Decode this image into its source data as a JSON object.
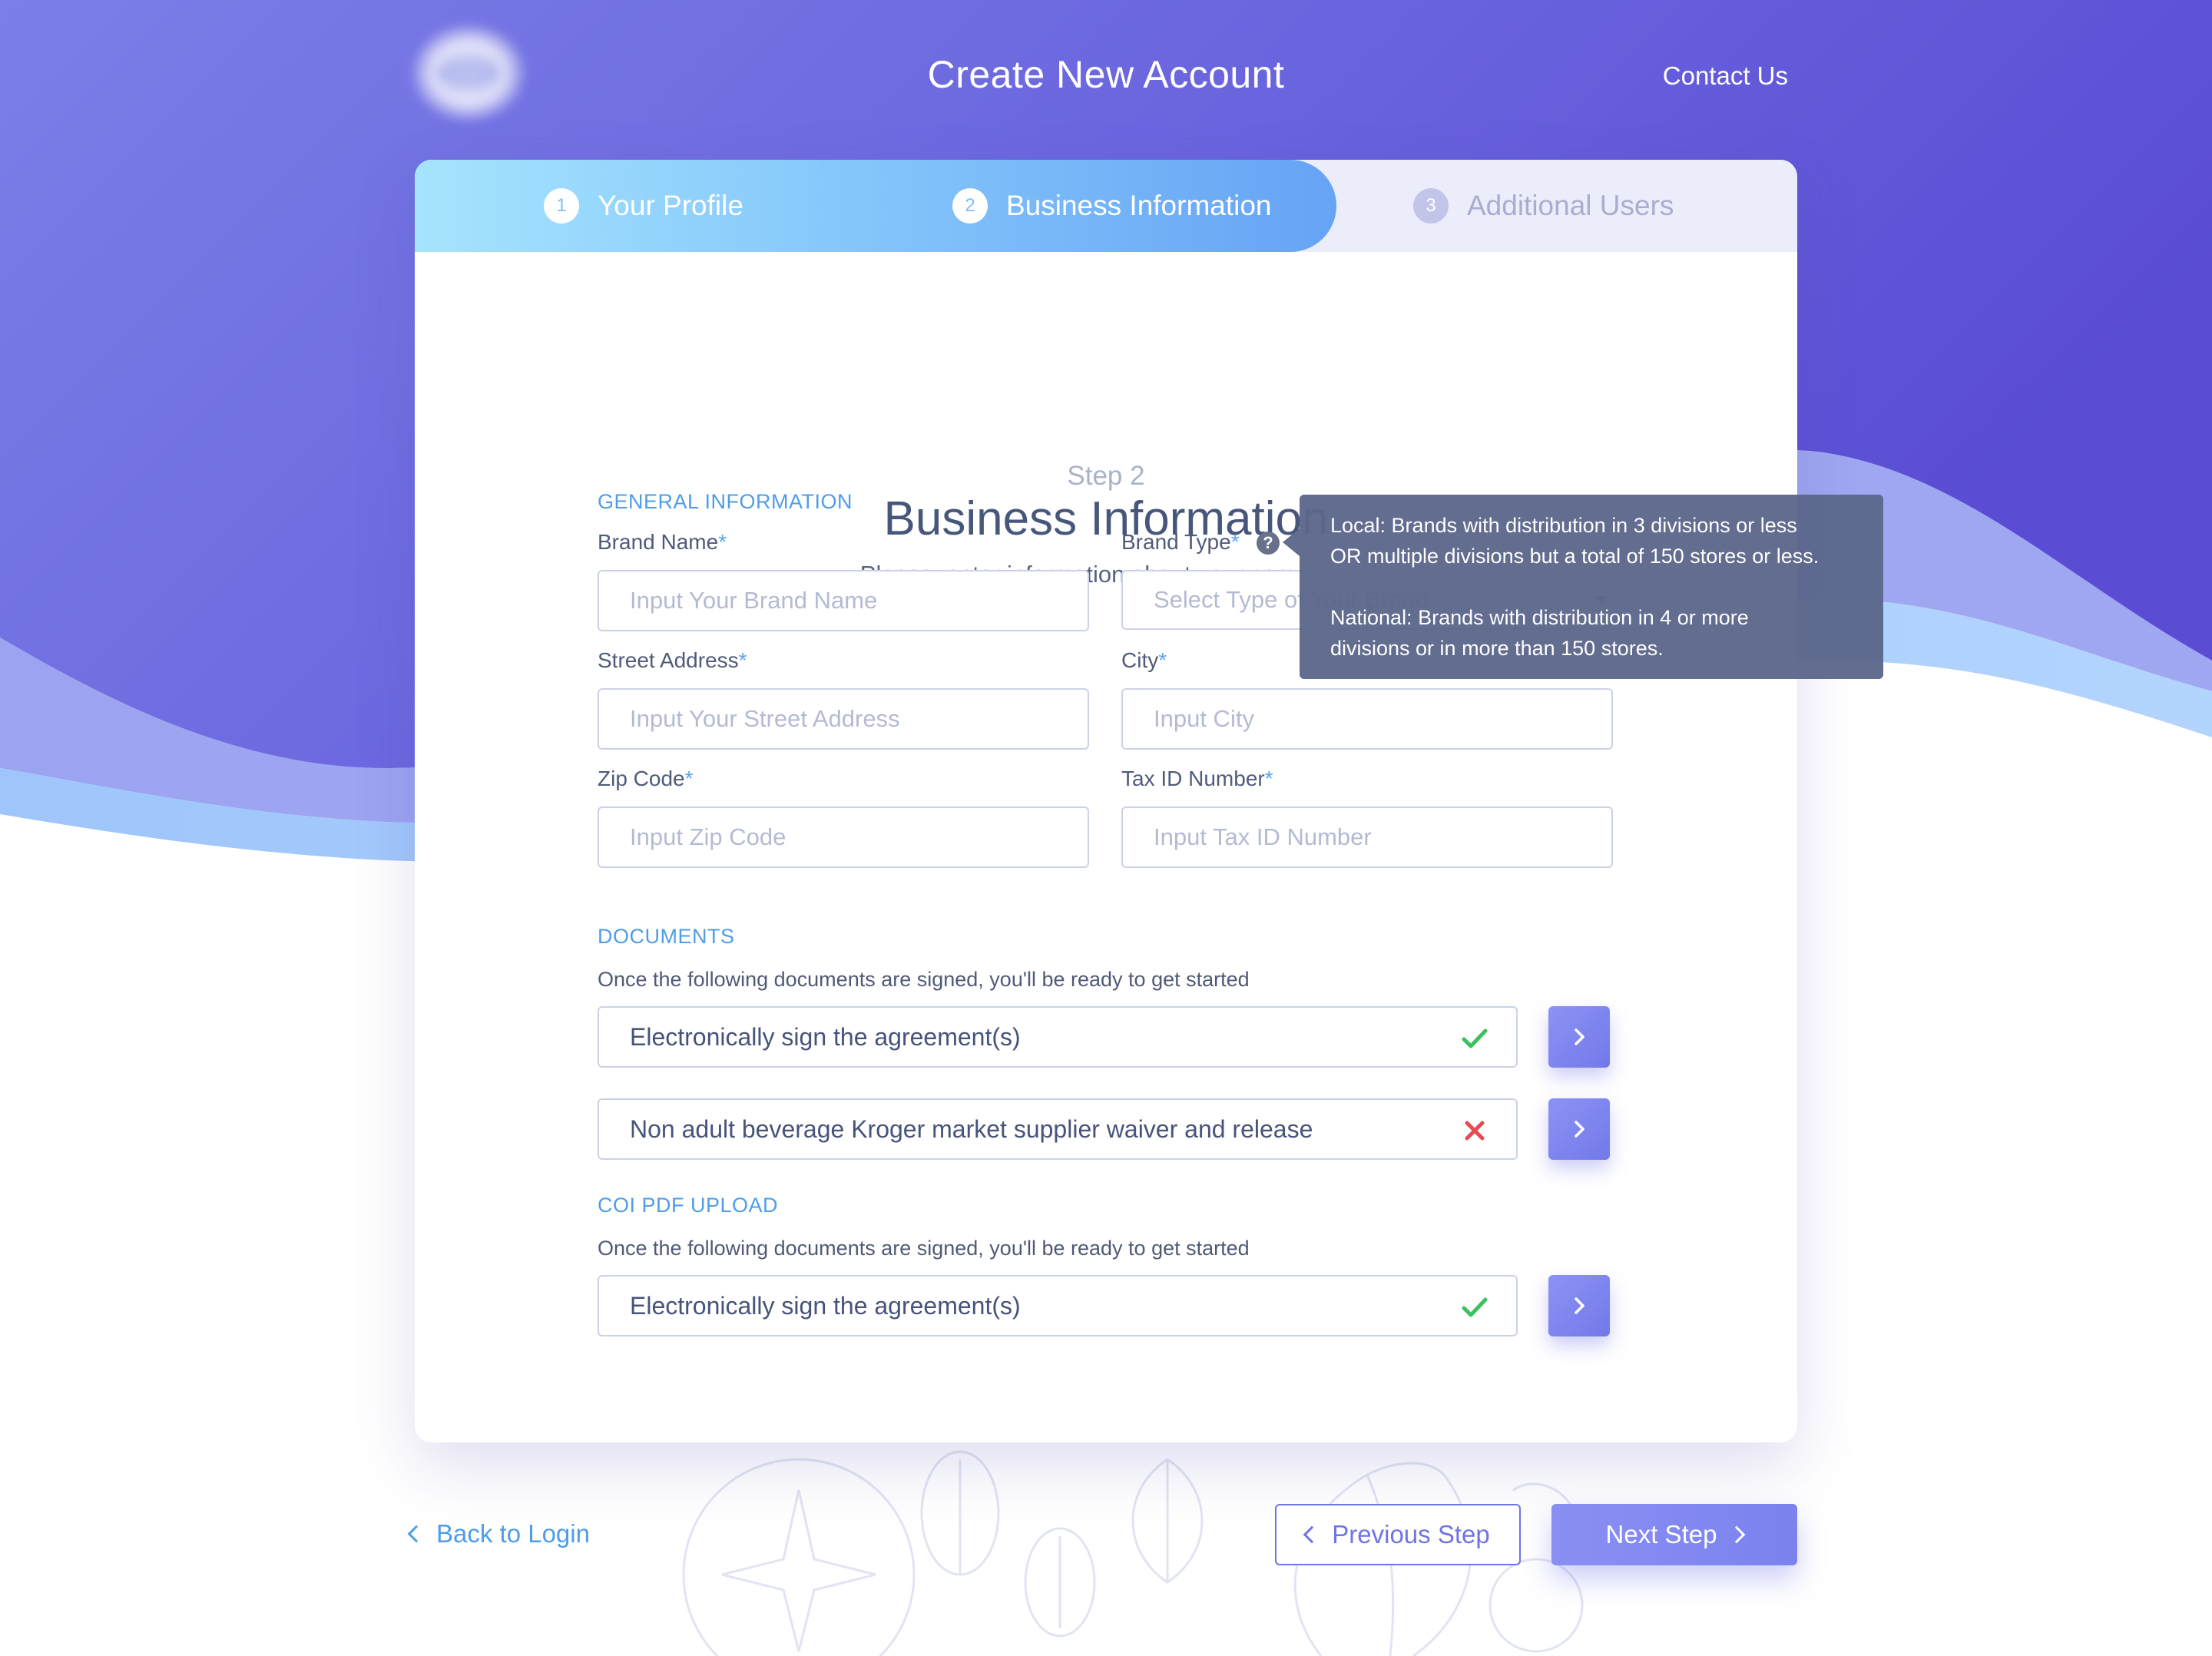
{
  "header": {
    "title": "Create New Account",
    "contact_label": "Contact Us"
  },
  "stepper": {
    "steps": [
      {
        "number": "1",
        "label": "Your Profile",
        "state": "done"
      },
      {
        "number": "2",
        "label": "Business Information",
        "state": "current"
      },
      {
        "number": "3",
        "label": "Additional Users",
        "state": "todo"
      }
    ]
  },
  "intro": {
    "step_label": "Step 2",
    "heading": "Business Information",
    "subtitle": "Please, enter information about your company."
  },
  "general": {
    "section_title": "GENERAL INFORMATION",
    "brand_name": {
      "label": "Brand Name",
      "required": "*",
      "placeholder": "Input Your Brand Name"
    },
    "brand_type": {
      "label": "Brand Type",
      "required": "*",
      "placeholder": "Select Type of Your Brand"
    },
    "street": {
      "label": "Street Address",
      "required": "*",
      "placeholder": "Input Your Street Address"
    },
    "city": {
      "label": "City",
      "required": "*",
      "placeholder": "Input City"
    },
    "zip": {
      "label": "Zip Code",
      "required": "*",
      "placeholder": "Input Zip Code"
    },
    "tax": {
      "label": "Tax ID Number",
      "required": "*",
      "placeholder": "Input Tax ID Number"
    }
  },
  "tooltip": {
    "local_line1": "Local: Brands with distribution in 3 divisions or less",
    "local_line2": "OR multiple divisions but a total of 150 stores or less.",
    "national_line1": "National: Brands with distribution in 4 or more",
    "national_line2": "divisions or in more than 150 stores."
  },
  "documents": {
    "section_title": "DOCUMENTS",
    "hint": "Once the following documents are signed, you'll be ready to get started",
    "items": [
      {
        "label": "Electronically sign the agreement(s)",
        "status": "signed"
      },
      {
        "label": "Non adult beverage Kroger market supplier waiver and release",
        "status": "unsigned"
      }
    ]
  },
  "coi": {
    "section_title": "COI PDF UPLOAD",
    "hint": "Once the following documents are signed, you'll be ready to get started",
    "items": [
      {
        "label": "Electronically sign the agreement(s)",
        "status": "signed"
      }
    ]
  },
  "footer": {
    "back_label": "Back to Login",
    "prev_label": "Previous Step",
    "next_label": "Next Step"
  },
  "colors": {
    "brand_purple": "#6f74e4",
    "accent_blue": "#4f9de8",
    "success_green": "#3cc15f",
    "error_red": "#e84a4f"
  },
  "icons": {
    "help": "question-circle-icon",
    "signed": "check-icon",
    "unsigned": "cross-icon",
    "go": "chevron-right-icon",
    "back": "chevron-left-icon"
  }
}
